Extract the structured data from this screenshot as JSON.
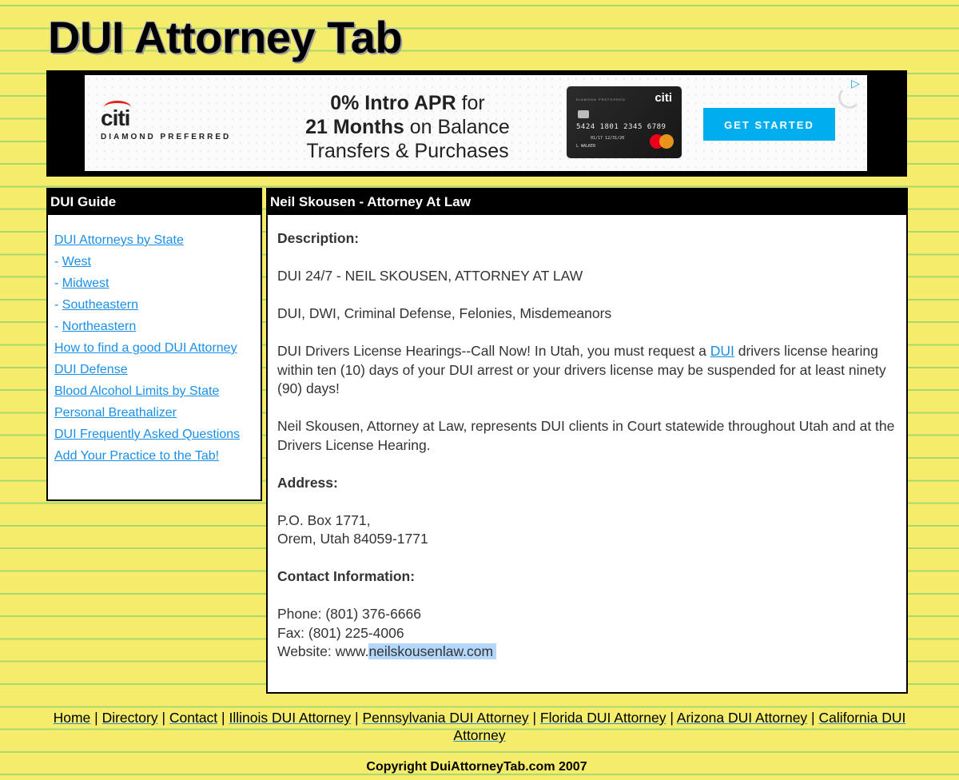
{
  "site": {
    "title": "DUI Attorney Tab"
  },
  "ad": {
    "brand": "citi",
    "product": "DIAMOND PREFERRED",
    "headline_bold_1": "0% Intro APR",
    "headline_rest_1": " for",
    "headline_bold_2": "21 Months",
    "headline_rest_2": " on Balance",
    "headline_line_3": "Transfers & Purchases",
    "card": {
      "brand_text": "DIAMOND PREFERRED",
      "logo": "citi",
      "number": "5424 1801 2345 6789",
      "dates": "01/17  12/31/20",
      "name": "L WALKER"
    },
    "cta_label": "GET STARTED",
    "adchoices_icon": "adchoices-icon",
    "colors": {
      "cta": "#00aeef",
      "logo_arc": "#e3261c"
    }
  },
  "sidebar": {
    "title": "DUI Guide",
    "items": [
      {
        "prefix": "",
        "label": "DUI Attorneys by State"
      },
      {
        "prefix": " - ",
        "label": "West"
      },
      {
        "prefix": " - ",
        "label": "Midwest"
      },
      {
        "prefix": " - ",
        "label": "Southeastern"
      },
      {
        "prefix": " - ",
        "label": "Northeastern"
      },
      {
        "prefix": "",
        "label": "How to find a good DUI Attorney"
      },
      {
        "prefix": "",
        "label": "DUI Defense"
      },
      {
        "prefix": "",
        "label": "Blood Alcohol Limits by State"
      },
      {
        "prefix": "",
        "label": "Personal Breathalizer"
      },
      {
        "prefix": "",
        "label": "DUI Frequently Asked Questions"
      },
      {
        "prefix": "",
        "label": "Add Your Practice to the Tab!"
      }
    ]
  },
  "main": {
    "title": "Neil Skousen - Attorney At Law",
    "description_label": "Description:",
    "desc_1": "DUI 24/7 - NEIL SKOUSEN, ATTORNEY AT LAW",
    "desc_2": "DUI, DWI, Criminal Defense, Felonies, Misdemeanors",
    "desc_3_before": "DUI Drivers License Hearings--Call Now! In Utah, you must request a ",
    "desc_3_link": "DUI",
    "desc_3_after": " drivers license hearing within ten (10) days of your DUI arrest or your drivers license may be suspended for at least ninety (90) days!",
    "desc_4": "Neil Skousen, Attorney at Law, represents DUI clients in Court statewide throughout Utah and at the Drivers License Hearing.",
    "address_label": "Address:",
    "address_line_1": "P.O. Box 1771,",
    "address_line_2": "Orem, Utah 84059-1771",
    "contact_label": "Contact Information:",
    "phone": "Phone: (801) 376-6666",
    "fax": "Fax: (801) 225-4006",
    "website_prefix": "Website: www.",
    "website_selected": "neilskousenlaw.com"
  },
  "footer": {
    "links": [
      "Home",
      "Directory",
      "Contact",
      "Illinois DUI Attorney",
      "Pennsylvania DUI Attorney",
      "Florida DUI Attorney",
      "Arizona DUI Attorney",
      "California DUI Attorney"
    ],
    "separator": " | ",
    "copyright": "Copyright DuiAttorneyTab.com 2007"
  },
  "colors": {
    "background": "#f4ec6a",
    "ruled_line": "#a9d86e",
    "link": "#1a8fe8",
    "header_bg": "#000000",
    "selection": "#b3d7fd"
  }
}
